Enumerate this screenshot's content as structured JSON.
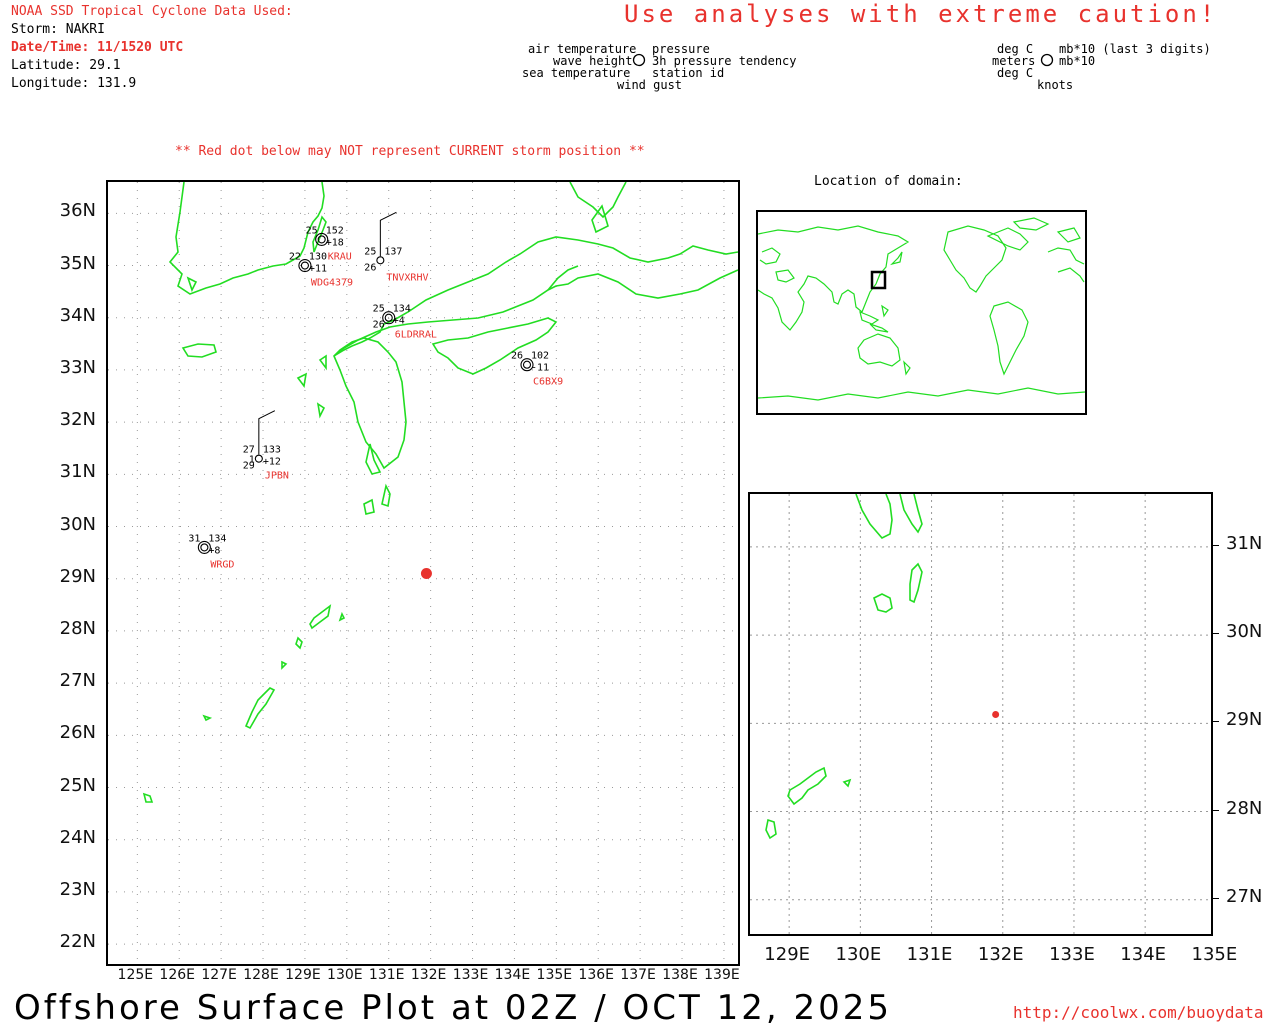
{
  "header": {
    "source": "NOAA SSD Tropical Cyclone Data Used:",
    "storm": "Storm: NAKRI",
    "datetime": "Date/Time: 11/1520 UTC",
    "latitude": "Latitude: 29.1",
    "longitude": "Longitude: 131.9"
  },
  "caution": "Use analyses with extreme caution!",
  "legend": {
    "air_temperature": "air temperature",
    "pressure": "pressure",
    "wave_height": "wave height",
    "pressure_tendency": "3h pressure tendency",
    "sea_temperature": "sea temperature",
    "station_id": "station id",
    "wind_gust": "wind gust",
    "unit_air": "deg C",
    "unit_pressure": "mb*10 (last 3 digits)",
    "unit_wave": "meters",
    "unit_tendency": "mb*10",
    "unit_sea": "deg C",
    "unit_wind": "knots"
  },
  "warning": "** Red dot below may NOT represent CURRENT storm position **",
  "location_title": "Location of domain:",
  "main_map": {
    "lat_labels": [
      "36N",
      "35N",
      "34N",
      "33N",
      "32N",
      "31N",
      "30N",
      "29N",
      "28N",
      "27N",
      "26N",
      "25N",
      "24N",
      "23N",
      "22N"
    ],
    "lon_labels": [
      "125E",
      "126E",
      "127E",
      "128E",
      "129E",
      "130E",
      "131E",
      "132E",
      "133E",
      "134E",
      "135E",
      "136E",
      "137E",
      "138E",
      "139E"
    ],
    "storm": {
      "lat": 29.1,
      "lon": 131.9
    }
  },
  "zoom_map": {
    "lat_labels": [
      "31N",
      "30N",
      "29N",
      "28N",
      "27N"
    ],
    "lon_labels": [
      "129E",
      "130E",
      "131E",
      "132E",
      "133E",
      "134E",
      "135E"
    ]
  },
  "stations": [
    {
      "id": "KRAU",
      "air": "25",
      "pressure": "152",
      "tendency": "+18"
    },
    {
      "id": "WDG4379",
      "air": "22",
      "pressure": "130",
      "tendency": "+11"
    },
    {
      "id": "TNVXRHV",
      "air": "25",
      "pressure": "137",
      "sea": "26"
    },
    {
      "id": "6LDRRAL",
      "air": "25",
      "pressure": "134",
      "sea": "26",
      "tendency": "+4"
    },
    {
      "id": "C6BX9",
      "air": "26",
      "pressure": "102",
      "tendency": "-11"
    },
    {
      "id": "JPBN",
      "air": "27",
      "wave": "1",
      "pressure": "133",
      "tendency": "+12",
      "sea": "29"
    },
    {
      "id": "WRGD",
      "air": "31",
      "pressure": "134",
      "tendency": "+8"
    }
  ],
  "footer": {
    "title": "Offshore Surface Plot at 02Z / OCT 12, 2025",
    "url": "http://coolwx.com/buoydata"
  },
  "colors": {
    "coast": "#22dd22",
    "accent": "#e8322d",
    "grid": "#999999"
  }
}
